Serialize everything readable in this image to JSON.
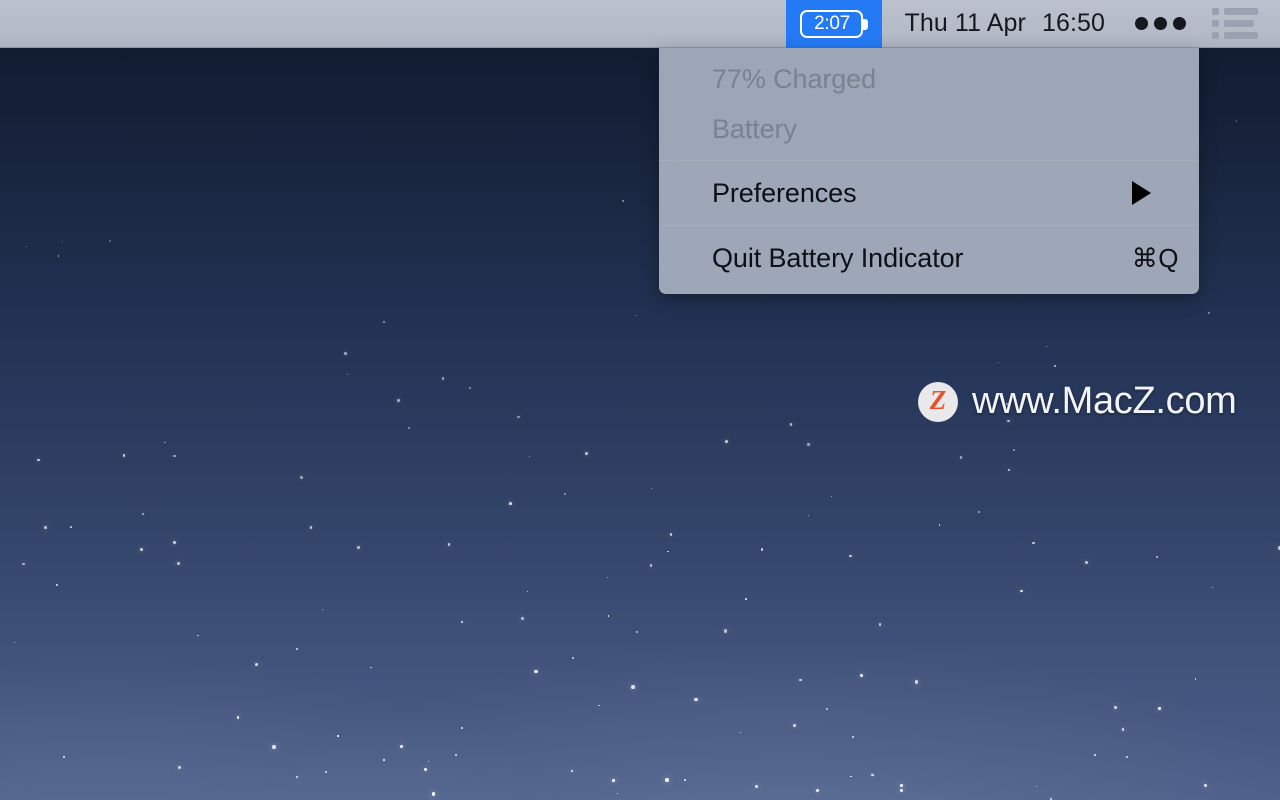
{
  "menubar": {
    "battery_status": {
      "icon": "battery-icon",
      "time_remaining": "2:07",
      "highlight_color": "#2479f4"
    },
    "clock": {
      "date": "Thu 11 Apr",
      "time": "16:50"
    },
    "control_center": {
      "icon": "control-center-icon",
      "label": "Control Center"
    },
    "notification_center": {
      "icon": "notification-center-icon",
      "label": "Notification Center"
    }
  },
  "battery_menu": {
    "status_lines": [
      {
        "text": "77% Charged",
        "enabled": false
      },
      {
        "text": "Battery",
        "enabled": false
      }
    ],
    "items": [
      {
        "label": "Preferences",
        "shortcut": "",
        "submenu": true
      },
      {
        "label": "Quit Battery Indicator",
        "shortcut": "⌘Q",
        "submenu": false
      }
    ]
  },
  "watermark": {
    "logo_letter": "Z",
    "text": "www.MacZ.com"
  },
  "colors": {
    "menubar_bg": "#b4bac6",
    "menu_bg": "#a9b2c1",
    "accent": "#2479f4",
    "logo_orange": "#e8512a",
    "desktop_top": "#101a2d",
    "desktop_bottom": "#4d5f88"
  }
}
